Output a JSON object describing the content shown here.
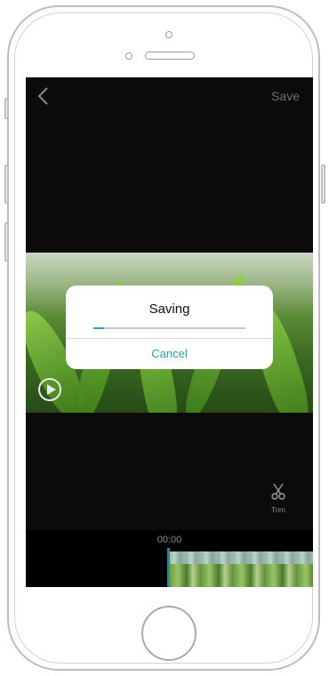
{
  "header": {
    "save_label": "Save"
  },
  "editor": {
    "current_time": "00:00",
    "trim_label": "Trim"
  },
  "dialog": {
    "title": "Saving",
    "progress": 0.07,
    "cancel_label": "Cancel"
  },
  "colors": {
    "accent": "#2aa8a8",
    "screen_bg": "#0b0b0b",
    "dialog_bg": "#ffffff"
  },
  "icons": {
    "back": "chevron-left-icon",
    "play": "play-circle-icon",
    "trim": "scissors-icon"
  }
}
